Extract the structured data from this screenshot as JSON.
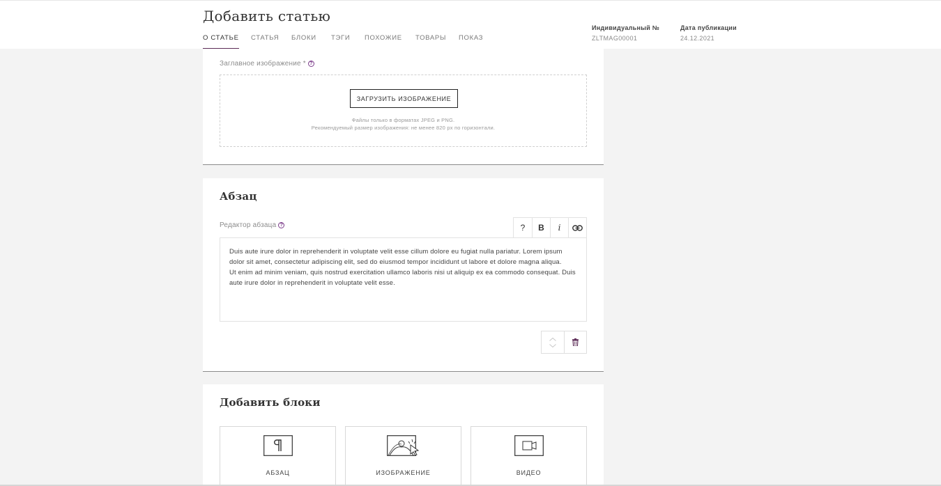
{
  "header": {
    "title": "Добавить статью",
    "tabs": [
      {
        "label": "О статье"
      },
      {
        "label": "Статья"
      },
      {
        "label": "Блоки"
      },
      {
        "label": "Тэги"
      },
      {
        "label": "Похожие"
      },
      {
        "label": "Товары"
      },
      {
        "label": "Показ"
      }
    ],
    "active_tab": "О статье",
    "meta": {
      "id_label": "Индивидуальный №",
      "id_value": "ZLTMAG00001",
      "date_label": "Дата публикации",
      "date_value": "24.12.2021"
    }
  },
  "cover_image": {
    "label": "Заглавное изображение *",
    "upload_button": "ЗАГРУЗИТЬ ИЗОБРАЖЕНИЕ",
    "hint_line1": "Файлы только в форматах JPEG и PNG.",
    "hint_line2": "Рекомендуемый размер изображения: не менее 820 px по горизонтали."
  },
  "paragraph_block": {
    "title": "Абзац",
    "editor_label": "Редактор абзаца",
    "toolbar": {
      "help": "?",
      "bold": "B",
      "italic": "i",
      "link_icon": "link-icon"
    },
    "text_line1": "Duis aute irure dolor in reprehenderit in voluptate velit esse cillum dolore eu fugiat nulla pariatur. Lorem ipsum dolor sit amet, consectetur adipiscing elit, sed do eiusmod tempor incididunt ut labore et dolore magna aliqua.",
    "text_line2": "Ut enim ad minim veniam, quis nostrud exercitation ullamco laboris nisi ut aliquip ex ea commodo consequat. Duis aute irure dolor in reprehenderit in voluptate velit esse."
  },
  "add_blocks": {
    "title": "Добавить блоки",
    "tiles": [
      {
        "label": "АБЗАЦ",
        "icon": "paragraph-icon"
      },
      {
        "label": "ИЗОБРАЖЕНИЕ",
        "icon": "image-icon"
      },
      {
        "label": "ВИДЕО",
        "icon": "video-icon"
      }
    ]
  },
  "colors": {
    "accent": "#5b2a55",
    "help_icon": "#7b3b8a",
    "background": "#f3f3f3"
  }
}
